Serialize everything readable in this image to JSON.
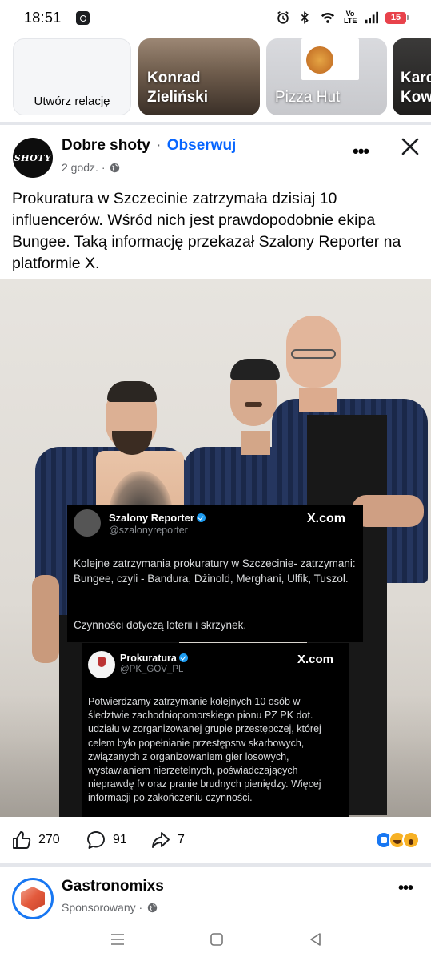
{
  "status_bar": {
    "time": "18:51",
    "volte": "Vo LTE",
    "battery_level": "15",
    "icons": [
      "app-notification-icon",
      "alarm-icon",
      "bluetooth-icon",
      "wifi-icon",
      "volte-icon",
      "signal-icon",
      "battery-icon"
    ]
  },
  "stories": {
    "create_label": "Utwórz relację",
    "items": [
      {
        "name_line1": "Konrad",
        "name_line2": "Zieliński"
      },
      {
        "name_line1": "Pizza Hut",
        "name_line2": ""
      },
      {
        "name_line1": "Karo",
        "name_line2": "Kow"
      }
    ]
  },
  "post": {
    "page_name": "Dobre shoty",
    "separator": " · ",
    "follow_label": "Obserwuj",
    "time": "2 godz. ·",
    "avatar_text": "SHOTY",
    "text": "Prokuratura w Szczecinie zatrzymała dzisiaj 10 influencerów. Wśród nich jest prawdopodobnie ekipa Bungee. Taką informację przekazał Szalony Reporter na platformie X.",
    "tweet1": {
      "name": "Szalony Reporter",
      "handle": "@szalonyreporter",
      "source": "X.com",
      "body": "Kolejne zatrzymania prokuratury w Szczecinie- zatrzymani: Bungee, czyli - Bandura, Dżinold, Merghani, Ulfik, Tuszol.",
      "body2": "Czynności dotyczą loterii i skrzynek."
    },
    "tweet2": {
      "name": "Prokuratura",
      "handle": "@PK_GOV_PL",
      "source": "X.com",
      "body": "Potwierdzamy zatrzymanie kolejnych 10 osób w śledztwie zachodniopomorskiego pionu PZ PK dot. udziału w zorganizowanej grupie przestępczej, której celem było popełnianie przestępstw skarbowych, związanych z organizowaniem gier losowych, wystawianiem nierzetelnych, poświadczających nieprawdę fv oraz pranie brudnych pieniędzy. Więcej informacji po zakończeniu czynności."
    },
    "likes": "270",
    "comments": "91",
    "shares": "7",
    "reaction_icons": [
      "like-reaction-icon",
      "haha-reaction-icon",
      "wow-reaction-icon"
    ]
  },
  "next_post": {
    "page_name": "Gastronomixs",
    "subtitle": "Sponsorowany ·"
  },
  "colors": {
    "brand_blue": "#0866ff",
    "secondary_text": "#65676b",
    "divider": "#e4e6eb",
    "battery_red": "#e8424b"
  }
}
